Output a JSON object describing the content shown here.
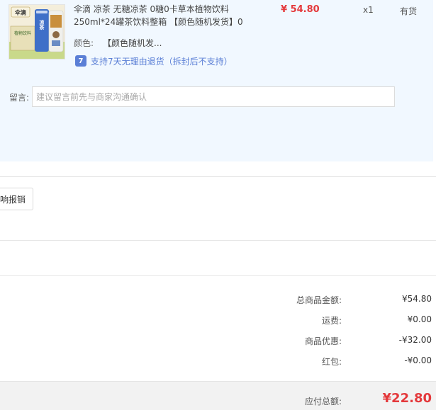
{
  "product": {
    "title": "伞滴 凉茶 无糖凉茶 0糖0卡草本植物饮料250ml*24罐茶饮料整箱 【颜色随机发货】0",
    "price": "¥ 54.80",
    "quantity": "x1",
    "stock": "有货",
    "attribute_label": "颜色:",
    "attribute_value": "【颜色随机发...",
    "return_badge": "7",
    "return_policy": "支持7天无理由退货（拆封后不支持）",
    "image_text_brand": "伞滴",
    "image_text_can": "凉茶",
    "image_text_box": "植物饮料"
  },
  "note": {
    "label": "留言:",
    "placeholder": "建议留言前先与商家沟通确认"
  },
  "invoice": {
    "button_label": "响报销"
  },
  "summary": {
    "rows": [
      {
        "label": "总商品金额:",
        "value": "¥54.80"
      },
      {
        "label": "运费:",
        "value": "¥0.00"
      },
      {
        "label": "商品优惠:",
        "value": "-¥32.00"
      },
      {
        "label": "红包:",
        "value": "-¥0.00"
      }
    ],
    "total_label": "应付总额:",
    "total_value": "¥22.80"
  },
  "colors": {
    "accent_red": "#e4393c",
    "panel_bg": "#f1f8ff",
    "link_blue": "#5b7fd6"
  }
}
